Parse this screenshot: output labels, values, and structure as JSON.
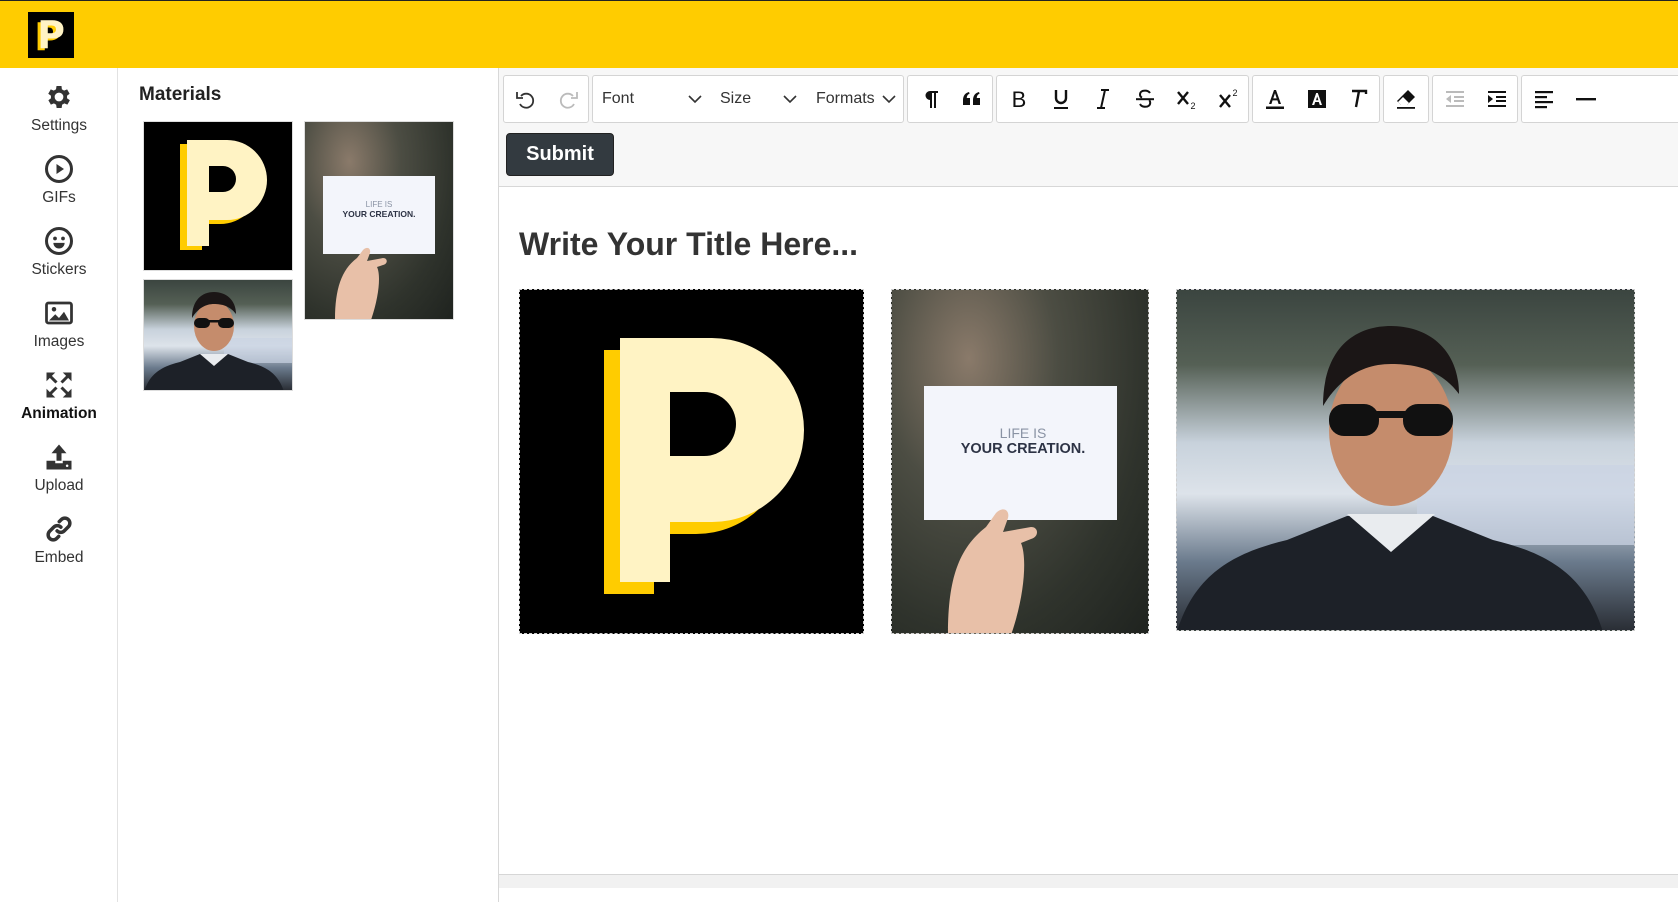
{
  "brand": {
    "logo_letter": "P",
    "accent": "#ffcc00",
    "logo_bg": "#000000"
  },
  "sidebar": {
    "items": [
      {
        "label": "Settings",
        "icon": "gear-icon"
      },
      {
        "label": "GIFs",
        "icon": "play-circle-icon"
      },
      {
        "label": "Stickers",
        "icon": "smiley-icon"
      },
      {
        "label": "Images",
        "icon": "image-icon"
      },
      {
        "label": "Animation",
        "icon": "expand-arrows-icon",
        "active": true
      },
      {
        "label": "Upload",
        "icon": "upload-icon"
      },
      {
        "label": "Embed",
        "icon": "link-icon"
      }
    ]
  },
  "materials": {
    "title": "Materials",
    "items": [
      {
        "kind": "logo",
        "alt": "P logo"
      },
      {
        "kind": "card",
        "card_line1": "LIFE IS",
        "card_line2": "YOUR CREATION."
      },
      {
        "kind": "photo",
        "alt": "man in sunglasses"
      }
    ]
  },
  "toolbar": {
    "undo": "undo-icon",
    "redo": "redo-icon",
    "font_label": "Font",
    "size_label": "Size",
    "formats_label": "Formats",
    "buttons": [
      "paragraph-icon",
      "blockquote-icon",
      "bold-icon",
      "underline-icon",
      "italic-icon",
      "strikethrough-icon",
      "subscript-icon",
      "superscript-icon",
      "font-color-icon",
      "highlight-icon",
      "clear-text-format-icon",
      "eraser-icon",
      "outdent-icon",
      "indent-icon",
      "align-left-icon",
      "horizontal-rule-icon"
    ],
    "submit_label": "Submit"
  },
  "document": {
    "title": "Write Your Title Here...",
    "images": [
      {
        "kind": "logo"
      },
      {
        "kind": "card",
        "card_line1": "LIFE IS",
        "card_line2": "YOUR CREATION."
      },
      {
        "kind": "photo"
      }
    ]
  }
}
